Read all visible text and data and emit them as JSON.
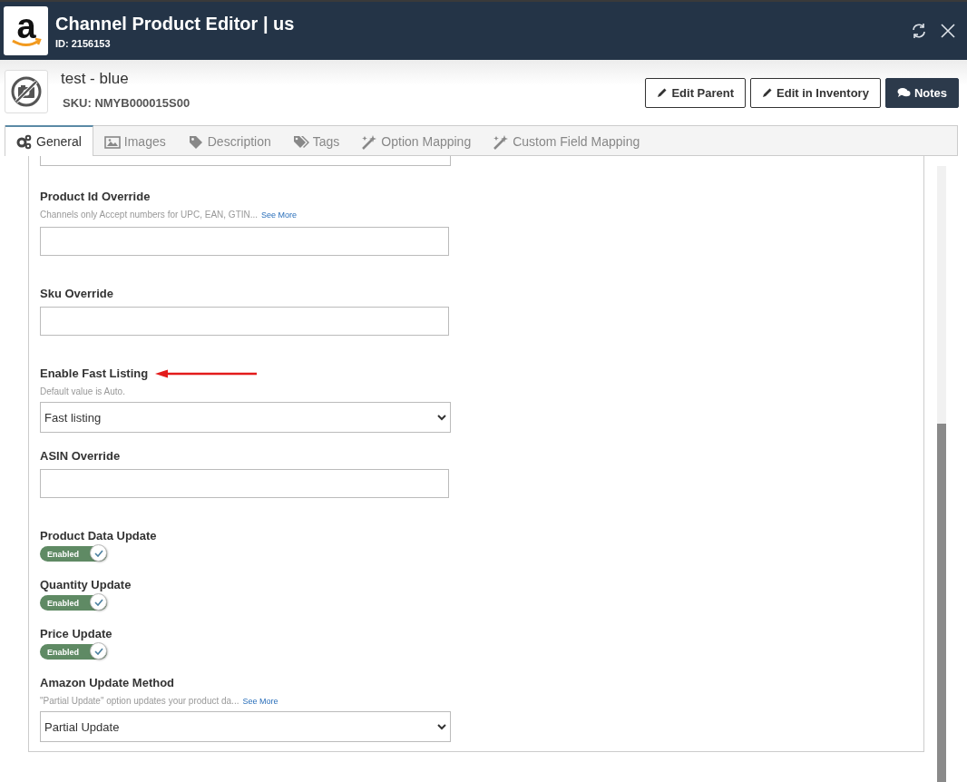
{
  "window": {
    "logo_text": "a",
    "title": "Channel Product Editor | us",
    "id_text": "ID: 2156153"
  },
  "product": {
    "name": "test - blue",
    "sku": "SKU: NMYB000015S00"
  },
  "actions": [
    {
      "label": "Edit Parent",
      "kind": "edit",
      "primary": false
    },
    {
      "label": "Edit in Inventory",
      "kind": "edit",
      "primary": false
    },
    {
      "label": "Notes",
      "kind": "notes",
      "primary": true
    }
  ],
  "tabs": [
    {
      "label": "General",
      "selected": true
    },
    {
      "label": "Images",
      "selected": false
    },
    {
      "label": "Description",
      "selected": false
    },
    {
      "label": "Tags",
      "selected": false
    },
    {
      "label": "Option Mapping",
      "selected": false
    },
    {
      "label": "Custom Field Mapping",
      "selected": false
    }
  ],
  "fields": [
    {
      "kind": "cut-input"
    },
    {
      "kind": "input",
      "label": "Product Id Override",
      "hint": "Channels only Accept numbers for UPC, EAN, GTIN...",
      "link": "See More"
    },
    {
      "kind": "input",
      "label": "Sku Override"
    },
    {
      "kind": "select",
      "label": "Enable Fast Listing",
      "hint": "Default value is Auto.",
      "value": "Fast listing",
      "annotated": true
    },
    {
      "kind": "input",
      "label": "ASIN Override"
    },
    {
      "kind": "toggle",
      "label": "Product Data Update",
      "state_text": "Enabled",
      "on": true
    },
    {
      "kind": "toggle",
      "label": "Quantity Update",
      "state_text": "Enabled",
      "on": true
    },
    {
      "kind": "toggle",
      "label": "Price Update",
      "state_text": "Enabled",
      "on": true
    },
    {
      "kind": "select",
      "label": "Amazon Update Method",
      "hint": "\"Partial Update\" option updates your product da...",
      "link": "See More",
      "value": "Partial Update"
    }
  ]
}
